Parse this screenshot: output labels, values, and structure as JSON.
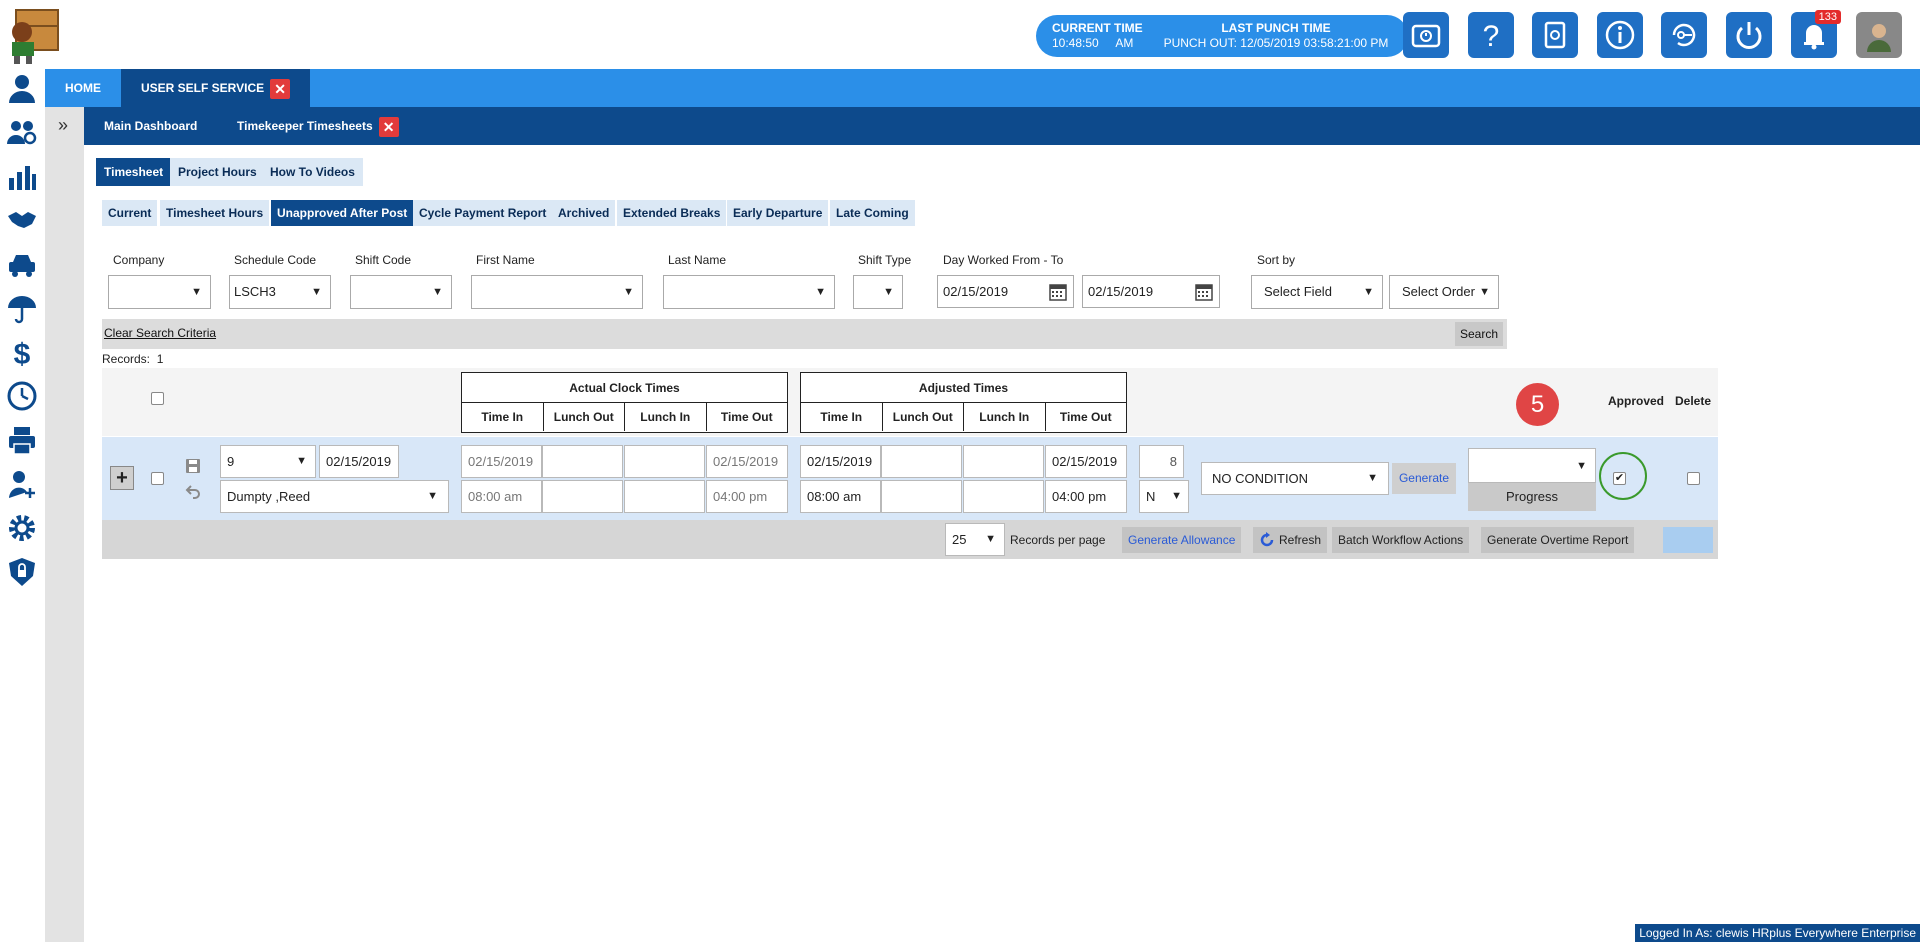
{
  "header": {
    "current_time_label": "CURRENT TIME",
    "current_time_value": "10:48:50",
    "current_time_ampm": "AM",
    "last_punch_label": "LAST PUNCH TIME",
    "last_punch_value": "PUNCH OUT: 12/05/2019 03:58:21:00 PM",
    "notification_count": "133"
  },
  "nav": {
    "home": "HOME",
    "uss": "USER SELF SERVICE",
    "main_dashboard": "Main Dashboard",
    "timekeeper": "Timekeeper Timesheets"
  },
  "tabs": [
    "Timesheet",
    "Project Hours",
    "How To Videos"
  ],
  "subtabs": [
    "Current",
    "Timesheet Hours",
    "Unapproved After Post",
    "Cycle Payment Report",
    "Archived",
    "Extended Breaks",
    "Early Departure",
    "Late Coming"
  ],
  "filters": {
    "company_label": "Company",
    "schedule_label": "Schedule Code",
    "schedule_value": "LSCH3",
    "shift_code_label": "Shift Code",
    "first_name_label": "First Name",
    "last_name_label": "Last Name",
    "shift_type_label": "Shift Type",
    "day_worked_label": "Day Worked From - To",
    "date_from": "02/15/2019",
    "date_to": "02/15/2019",
    "sort_label": "Sort by",
    "sort_field": "Select Field",
    "sort_order": "Select Order"
  },
  "search": {
    "clear": "Clear Search Criteria",
    "button": "Search",
    "records_label": "Records:",
    "records_count": "1"
  },
  "table": {
    "actual_title": "Actual Clock Times",
    "adjusted_title": "Adjusted Times",
    "cols": [
      "Time In",
      "Lunch Out",
      "Lunch In",
      "Time Out"
    ],
    "approved": "Approved",
    "delete": "Delete",
    "step_number": "5"
  },
  "row": {
    "schedule": "9",
    "date": "02/15/2019",
    "employee": "Dumpty ,Reed",
    "actual_date_in": "02/15/2019",
    "actual_date_out": "02/15/2019",
    "actual_time_in": "08:00 am",
    "actual_time_out": "04:00 pm",
    "adj_date_in": "02/15/2019",
    "adj_date_out": "02/15/2019",
    "adj_time_in": "08:00 am",
    "adj_time_out": "04:00 pm",
    "hours": "8",
    "n_flag": "N",
    "condition": "NO CONDITION",
    "generate": "Generate",
    "progress": "Progress"
  },
  "footer": {
    "per_page": "25",
    "per_page_label": "Records per page",
    "gen_allowance": "Generate Allowance",
    "refresh": "Refresh",
    "batch": "Batch Workflow Actions",
    "overtime": "Generate Overtime Report"
  },
  "logged_in": "Logged In As: clewis HRplus Everywhere Enterprise"
}
